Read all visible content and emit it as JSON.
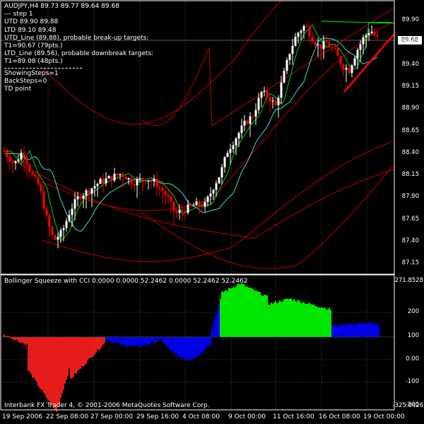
{
  "header": {
    "symbol_line": "AUDJPY,H4  89.73 89.77 89.64 89.68",
    "step": "---  step 1",
    "utd": "UTD 89.90  89.88",
    "ltd": "LTD 89.10  89.48",
    "utd_line": "UTD_Line (89.88), probable break-up targets:",
    "t1_up": "T1=90.67 (79pts.)",
    "ltd_line": "LTD_Line (89.56), probable downbreak targets:",
    "t1_down": "T1=89.08 (48pts.)",
    "showing_steps": "ShowingSteps=1",
    "back_steps": "BackSteps=0",
    "td_point": "TD point"
  },
  "current_price": "89.68",
  "price_axis": [
    "89.90",
    "89.65",
    "89.40",
    "89.15",
    "88.90",
    "88.65",
    "88.40",
    "88.15",
    "87.90",
    "87.65",
    "87.40",
    "87.15"
  ],
  "indicator": {
    "title": "Bollinger Squeeze with CCI 0.0000 0.0000 52.2462 0.0000 52.2462 52.2462",
    "axis": [
      "271.8528",
      "200",
      "100",
      "0.00",
      "-100",
      "-200",
      "-325.0426"
    ]
  },
  "time_axis": [
    "19 Sep 2006",
    "22 Sep 08:00",
    "27 Sep 00:00",
    "29 Sep 16:00",
    "4 Oct 08:00",
    "9 Oct 00:00",
    "11 Oct 16:00",
    "16 Oct 08:00",
    "19 Oct 00:00"
  ],
  "copyright": "Interbank FX Trader 4, © 2001-2006 MetaQuotes Software Corp.",
  "colors": {
    "bull": "#ffffff",
    "bear": "#ff0000",
    "bollinger": "#c00000",
    "ma_cyan": "#40e0d0",
    "ma_green": "#00cc00",
    "hist_red": "#ff2020",
    "hist_blue": "#0000ff",
    "hist_green": "#00ff00"
  }
}
